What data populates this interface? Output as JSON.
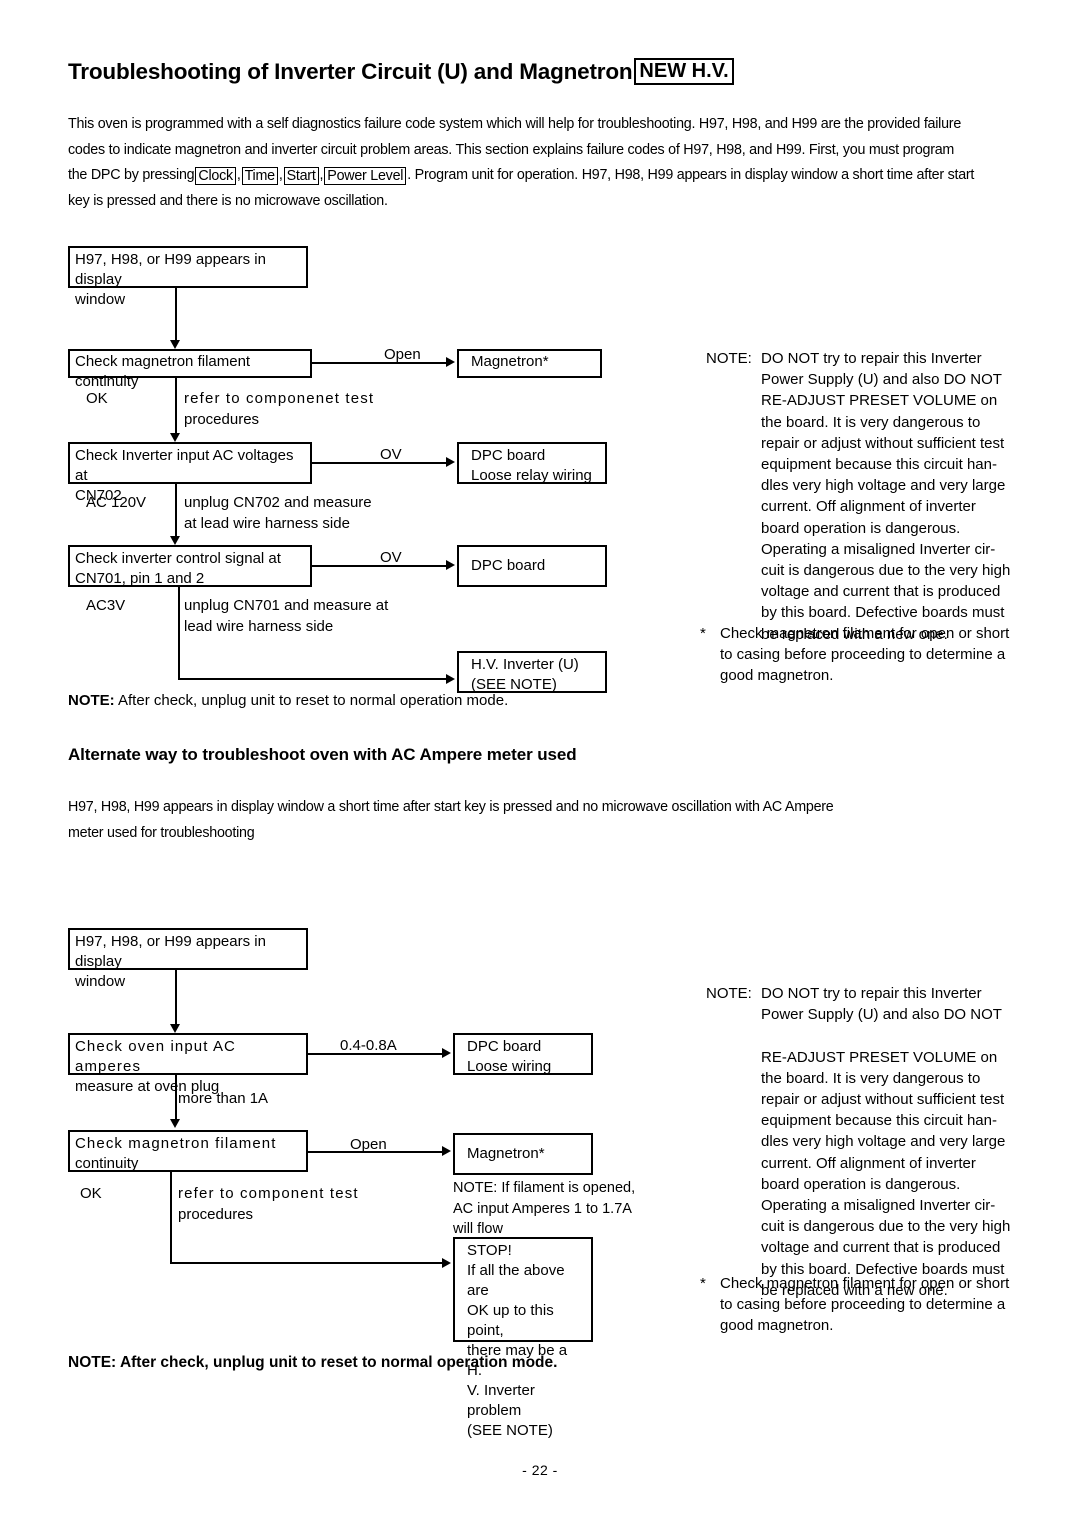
{
  "document": {
    "title_text": "Troubleshooting of Inverter Circuit (U) and Magnetron",
    "title_badge": "NEW H.V.",
    "page_number": "- 22 -"
  },
  "intro": {
    "line1": "This oven is programmed with a self diagnostics failure code system which will help for troubleshooting.  H97, H98, and H99 are the provided failure",
    "line2": "codes to indicate magnetron and inverter circuit problem areas.  This section explains failure codes of H97, H98, and H99.  First, you must program",
    "line3a": "the DPC by pressing",
    "key1": "Clock",
    "key2": "Time",
    "key3": "Start",
    "key4": "Power Level",
    "line3b": ".  Program unit for operation.  H97, H98, H99 appears in display window a short time after start",
    "line4": "key is pressed and there is no microwave oscillation."
  },
  "flow1": {
    "box_start_l1": "H97, H98, or H99 appears in display",
    "box_start_l2": "window",
    "box_check_filament": "Check magnetron filament continuity",
    "branch_open": "Open",
    "box_magnetron": "Magnetron*",
    "label_ok": "OK",
    "label_refer_l1": "refer to componenet test",
    "label_refer_l2": "procedures",
    "box_check_cn702_l1": "Check Inverter input AC voltages at",
    "box_check_cn702_l2": "CN702",
    "branch_ov_1": "OV",
    "box_dpc_relay_l1": "DPC board",
    "box_dpc_relay_l2": "Loose relay wiring",
    "label_ac120v": "AC 120V",
    "label_unplug702_l1": "unplug CN702 and measure",
    "label_unplug702_l2": "at lead wire harness side",
    "box_check_cn701_l1": "Check inverter control signal at",
    "box_check_cn701_l2": "CN701, pin 1 and 2",
    "branch_ov_2": "OV",
    "box_dpc": "DPC board",
    "label_ac3v": "AC3V",
    "label_unplug701_l1": "unplug CN701 and measure at",
    "label_unplug701_l2": "lead wire harness side",
    "box_hv_inverter_l1": "H.V. Inverter (U)",
    "box_hv_inverter_l2": "(SEE NOTE)",
    "note_bold": "NOTE:",
    "note_rest": "  After check, unplug unit to reset to normal operation mode."
  },
  "note1": {
    "label": "NOTE:",
    "lines": [
      "DO NOT try to repair this Inverter",
      "Power Supply (U) and also DO NOT",
      "RE-ADJUST PRESET VOLUME on",
      "the board.  It is very dangerous to",
      "repair or adjust without sufficient test",
      "equipment because this circuit han-",
      "dles very high voltage and very large",
      "current.  Off alignment of inverter",
      "board operation is dangerous.",
      "Operating a misaligned Inverter cir-",
      "cuit is dangerous due to the very high",
      "voltage and current that is produced",
      "by this board.  Defective boards must",
      "be replaced with a new one."
    ],
    "star": "*",
    "star_lines": [
      "Check magnetron filament for open or short",
      "to casing before proceeding to determine a",
      "good magnetron."
    ]
  },
  "section2": {
    "heading": "Alternate way to troubleshoot oven with AC Ampere meter used",
    "para_l1": "H97, H98, H99 appears in display window a short time after start key is pressed and no microwave oscillation with AC Ampere",
    "para_l2": "meter used for troubleshooting"
  },
  "flow2": {
    "box_start_l1": "H97, H98, or H99 appears in display",
    "box_start_l2": "window",
    "box_check_amperes_l1": "Check oven input AC amperes",
    "box_check_amperes_l2": "measure at oven plug",
    "branch_amps": "0.4-0.8A",
    "box_dpc_loose_l1": "DPC board",
    "box_dpc_loose_l2": "Loose wiring",
    "label_more_than_1a": "more than 1A",
    "box_check_filament_l1": "Check magnetron filament",
    "box_check_filament_l2": "continuity",
    "branch_open": "Open",
    "box_magnetron": "Magnetron*",
    "label_ok": "OK",
    "label_refer_l1": "refer to component test",
    "label_refer_l2": "procedures",
    "side_note_l1": "NOTE:  If filament is opened,",
    "side_note_l2": "AC input Amperes 1 to 1.7A",
    "side_note_l3": "will flow",
    "stop_lines": [
      "STOP!",
      "If all the above are",
      "OK up to this point,",
      "there may be a H.",
      "V. Inverter problem",
      "(SEE NOTE)"
    ],
    "note_bold_full": "NOTE:  After check, unplug unit to reset to normal operation mode."
  },
  "note2": {
    "label": "NOTE:",
    "lines": [
      "DO NOT try to repair this Inverter",
      "Power Supply (U) and also DO NOT",
      "",
      "RE-ADJUST PRESET VOLUME on",
      "the board.  It is very dangerous to",
      "repair or adjust without sufficient test",
      "equipment because this circuit han-",
      "dles very high voltage and very large",
      "current.  Off alignment of inverter",
      "board operation is dangerous.",
      "Operating a misaligned Inverter cir-",
      "cuit is dangerous due to the very high",
      "voltage and current that is produced",
      "by this board.  Defective boards must",
      "be replaced with a new one."
    ],
    "star": "*",
    "star_lines": [
      "Check magnetron filament for open or short",
      "to casing before proceeding to determine a",
      "good magnetron."
    ]
  }
}
